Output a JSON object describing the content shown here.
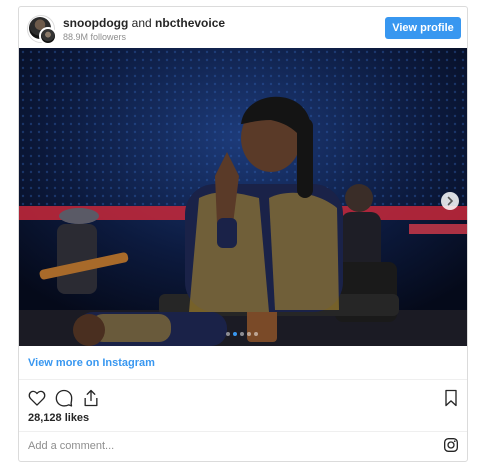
{
  "header": {
    "username_primary": "snoopdogg",
    "connector": "and",
    "username_secondary": "nbcthevoice",
    "followers": "88.9M followers",
    "view_profile_label": "View profile"
  },
  "post": {
    "carousel": {
      "slide_count": 5,
      "active_index": 1
    },
    "view_more_label": "View more on Instagram",
    "likes": "28,128 likes",
    "comment_placeholder": "Add a comment..."
  },
  "icons": {
    "like": "heart-icon",
    "comment": "comment-icon",
    "share": "share-icon",
    "save": "bookmark-icon",
    "brand": "instagram-icon",
    "next": "chevron-right-icon"
  },
  "colors": {
    "accent": "#3897f0",
    "border": "#dbdbdb",
    "muted": "#8e8e8e",
    "text": "#262626"
  }
}
